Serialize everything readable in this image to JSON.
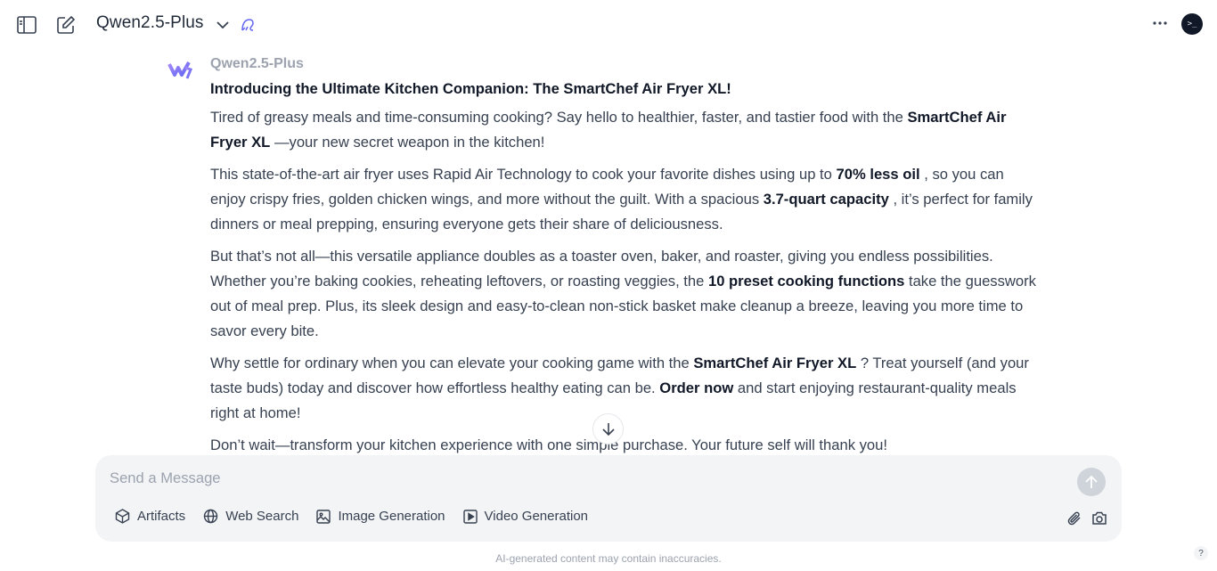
{
  "header": {
    "model_name": "Qwen2.5-Plus",
    "icons": [
      "sidebar-icon",
      "new-chat-icon",
      "chevron-down-icon",
      "model-badge-icon",
      "more-icon",
      "avatar"
    ],
    "avatar_text": ">_"
  },
  "message": {
    "sender": "Qwen2.5-Plus",
    "title": "Introducing the Ultimate Kitchen Companion: The SmartChef Air Fryer XL!",
    "p1_a": "Tired of greasy meals and time-consuming cooking? Say hello to healthier, faster, and tastier food with the ",
    "p1_b": "SmartChef Air Fryer XL",
    "p1_c": " —your new secret weapon in the kitchen!",
    "p2_a": "This state-of-the-art air fryer uses Rapid Air Technology to cook your favorite dishes using up to ",
    "p2_b": "70% less oil",
    "p2_c": " , so you can enjoy crispy fries, golden chicken wings, and more without the guilt. With a spacious ",
    "p2_d": "3.7-quart capacity",
    "p2_e": " , it’s perfect for family dinners or meal prepping, ensuring everyone gets their share of deliciousness.",
    "p3_a": "But that’s not all—this versatile appliance doubles as a toaster oven, baker, and roaster, giving you endless possibilities. Whether you’re baking cookies, reheating leftovers, or roasting veggies, the ",
    "p3_b": "10 preset cooking functions",
    "p3_c": " take the guesswork out of meal prep. Plus, its sleek design and easy-to-clean non-stick basket make cleanup a breeze, leaving you more time to savor every bite.",
    "p4_a": "Why settle for ordinary when you can elevate your cooking game with the ",
    "p4_b": "SmartChef Air Fryer XL",
    "p4_c": " ? Treat yourself (and your taste buds) today and discover how effortless healthy eating can be. ",
    "p4_d": "Order now",
    "p4_e": " and start enjoying restaurant-quality meals right at home!",
    "p5": "Don’t wait—transform your kitchen experience with one simple purchase. Your future self will thank you!"
  },
  "composer": {
    "placeholder": "Send a Message",
    "tools": [
      {
        "label": "Artifacts",
        "icon": "cube-icon"
      },
      {
        "label": "Web Search",
        "icon": "globe-icon"
      },
      {
        "label": "Image Generation",
        "icon": "image-icon"
      },
      {
        "label": "Video Generation",
        "icon": "video-icon"
      }
    ]
  },
  "footer": {
    "disclaimer": "AI-generated content may contain inaccuracies.",
    "help": "?"
  }
}
